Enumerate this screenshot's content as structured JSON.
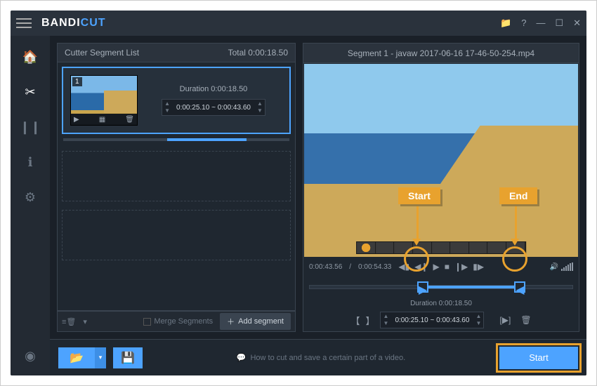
{
  "logo": {
    "b": "BANDI",
    "c": "CUT"
  },
  "titlebar": {
    "folder": "📁",
    "help": "?",
    "min": "—",
    "max": "☐",
    "close": "✕"
  },
  "sidebar": {
    "home": "🏠",
    "cut": "✂",
    "join": "❙❙",
    "info": "ℹ",
    "gear": "⚙",
    "rec": "◉"
  },
  "seglist": {
    "title": "Cutter Segment List",
    "total_label": "Total 0:00:18.50",
    "duration_label": "Duration 0:00:18.50",
    "range": "0:00:25.10  ~  0:00:43.60",
    "seg_index": "1",
    "thumb_play": "▶",
    "thumb_grid": "▦",
    "thumb_del": "🗑",
    "foot_del": "≡🗑",
    "foot_arrow": "▾",
    "merge_label": "Merge Segments",
    "add_label": "Add segment",
    "add_icon": "＋"
  },
  "preview": {
    "title": "Segment 1 - javaw 2017-06-16 17-46-50-254.mp4",
    "time_current": "0:00:43.56",
    "time_total": "0:00:54.33",
    "ctl_prevf": "◀▮",
    "ctl_prev": "◀❙",
    "ctl_play": "▶",
    "ctl_stop": "■",
    "ctl_next": "❙▶",
    "ctl_nextf": "▮▶",
    "vol_icon": "🔊",
    "trim_duration": "Duration  0:00:18.50",
    "trim_range": "0:00:25.10 ~ 0:00:43.60",
    "brk_l": "【",
    "brk_r": "】",
    "extra1": "[▶]",
    "extra2": "🗑"
  },
  "bottom": {
    "open": "📂",
    "open_dd": "▾",
    "save": "💾",
    "hint_icon": "💬",
    "hint": "How to cut and save a certain part of a video.",
    "start": "Start"
  },
  "anno": {
    "start": "Start",
    "end": "End"
  },
  "timeline": {
    "sel_left_pct": 43,
    "sel_right_pct": 80
  }
}
